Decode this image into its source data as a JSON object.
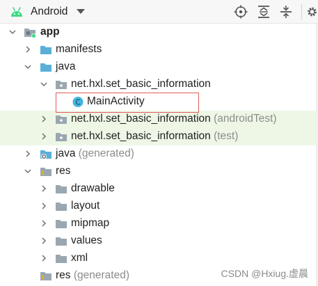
{
  "toolbar": {
    "view_label": "Android",
    "icons": [
      "android-icon",
      "dropdown-icon",
      "locate-icon",
      "expand-all-icon",
      "collapse-all-icon",
      "settings-icon"
    ]
  },
  "tree": {
    "app": {
      "label": "app"
    },
    "manifests": {
      "label": "manifests"
    },
    "java": {
      "label": "java"
    },
    "pkg_main": {
      "label": "net.hxl.set_basic_information"
    },
    "main_activity": {
      "label": "MainActivity"
    },
    "pkg_android_test": {
      "label": "net.hxl.set_basic_information",
      "suffix": "(androidTest)"
    },
    "pkg_test": {
      "label": "net.hxl.set_basic_information",
      "suffix": "(test)"
    },
    "java_generated": {
      "label": "java",
      "suffix": "(generated)"
    },
    "res": {
      "label": "res"
    },
    "drawable": {
      "label": "drawable"
    },
    "layout": {
      "label": "layout"
    },
    "mipmap": {
      "label": "mipmap"
    },
    "values": {
      "label": "values"
    },
    "xml": {
      "label": "xml"
    },
    "res_generated": {
      "label": "res",
      "suffix": "(generated)"
    }
  },
  "watermark": "CSDN @Hxiug.虚晨",
  "colors": {
    "android_green": "#3ddc84",
    "folder_blue": "#5aafd8",
    "folder_gray": "#9aa7b0",
    "class_cyan": "#40b6e0",
    "selection_border": "#e05b5b",
    "highlight_row": "#eef7e6"
  }
}
